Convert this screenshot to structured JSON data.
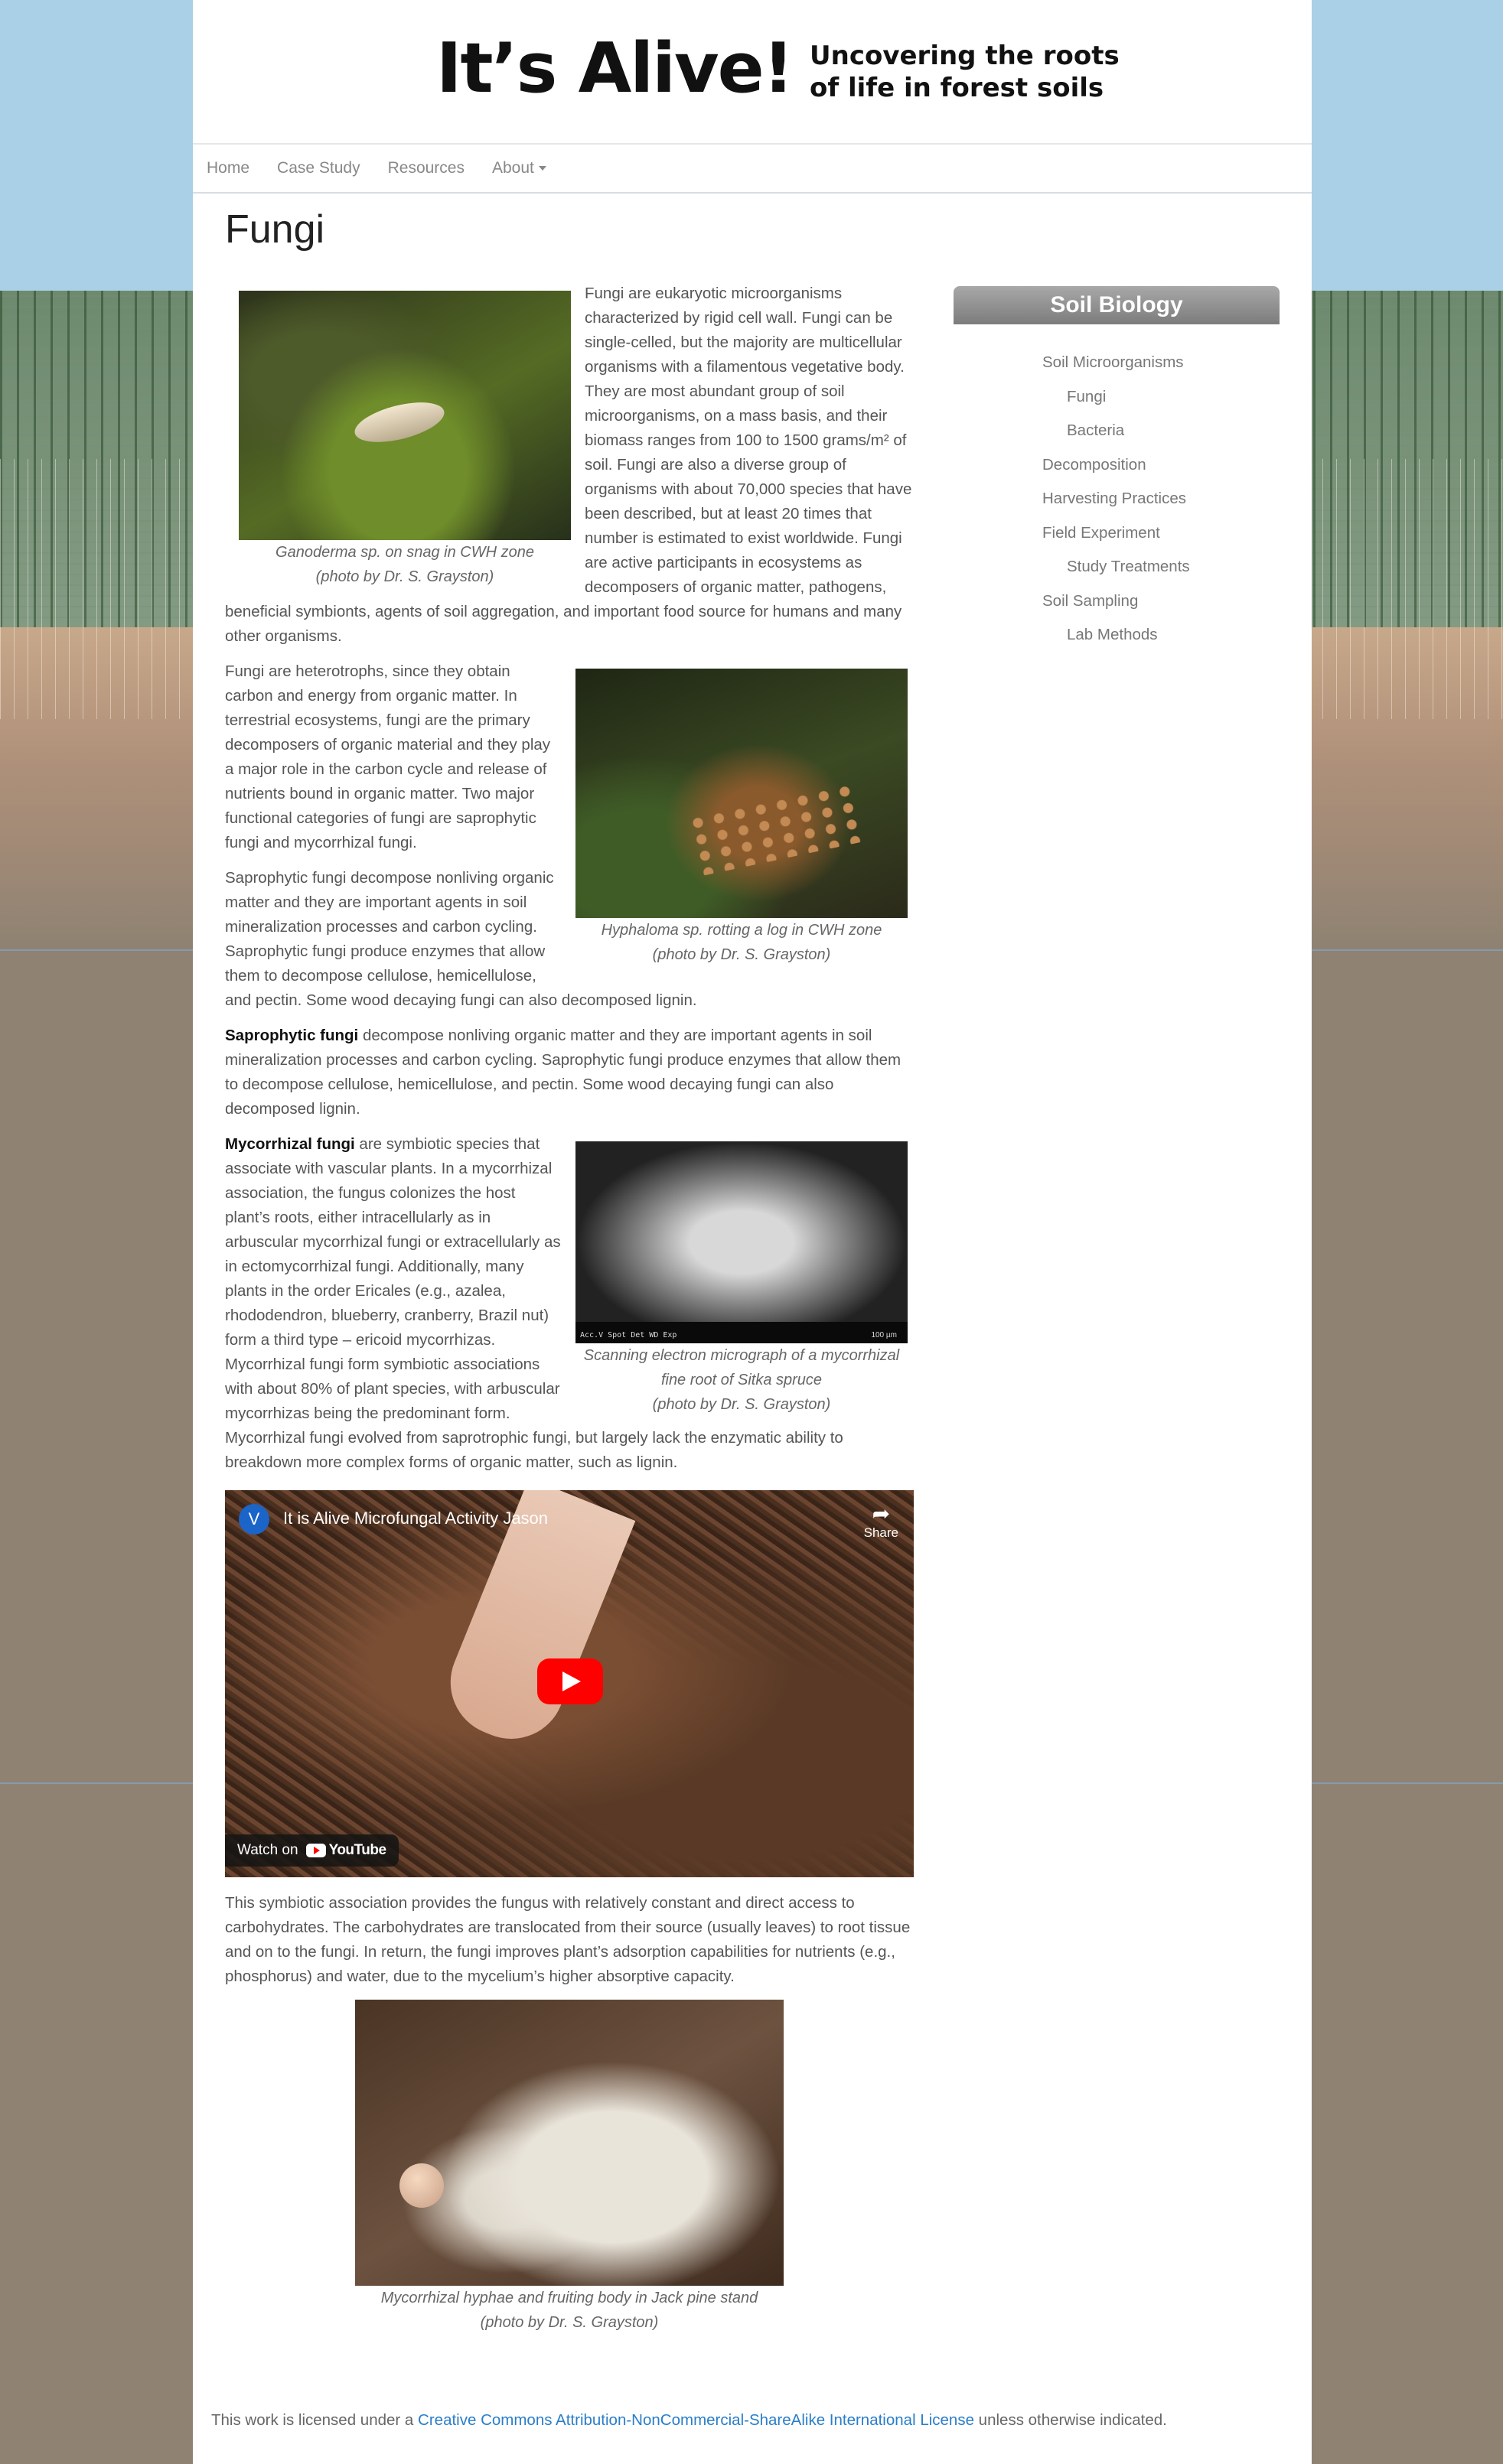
{
  "site": {
    "brand": "It’s Alive!",
    "tagline_line1": "Uncovering the roots",
    "tagline_line2": "of life in forest soils"
  },
  "nav": {
    "home": "Home",
    "case_study": "Case Study",
    "resources": "Resources",
    "about": "About"
  },
  "page": {
    "title": "Fungi"
  },
  "content": {
    "intro": "Fungi are eukaryotic microorganisms characterized by rigid cell wall. Fungi can be single-celled, but the majority are multicellular organisms with a filamentous vegetative body. They are most abundant group of soil microorganisms, on a mass basis, and their biomass ranges from 100 to 1500 grams/m² of soil.  Fungi are also a diverse group of organisms with about 70,000 species that have been described, but at least 20 times that number is estimated to exist worldwide. Fungi are active participants in ecosystems as decomposers of organic matter, pathogens, beneficial symbionts, agents of soil aggregation, and important food source for humans and many other organisms.",
    "fig1_caption_line1": "Ganoderma sp. on snag in CWH zone",
    "fig1_caption_line2": "(photo by Dr. S. Grayston)",
    "heterotrophs": "Fungi are heterotrophs, since they obtain carbon and energy from organic matter. In terrestrial ecosystems, fungi are the primary decomposers of organic material and they play a major role in the carbon cycle and release of nutrients bound in organic matter. Two major functional categories of fungi are saprophytic fungi and mycorrhizal fungi.",
    "fig2_caption_line1": "Hyphaloma sp. rotting a log in CWH zone",
    "fig2_caption_line2": "(photo by Dr. S. Grayston)",
    "sapro_plain": "Saprophytic fungi decompose nonliving organic matter and they are important agents in soil mineralization processes and carbon cycling. Saprophytic fungi produce enzymes that allow them to decompose cellulose, hemicellulose, and pectin. Some wood decaying fungi can also decomposed lignin.",
    "sapro_bold_label": "Saprophytic fungi",
    "sapro_bold_rest": " decompose nonliving organic matter and they are important agents in soil mineralization processes and carbon cycling. Saprophytic fungi produce enzymes that allow them to decompose cellulose, hemicellulose, and pectin. Some wood decaying fungi can also decomposed lignin.",
    "myco_label": "Mycorrhizal fungi",
    "myco_rest": " are symbiotic species that associate with vascular plants. In a mycorrhizal association, the fungus colonizes the host plant’s roots, either intracellularly as in arbuscular mycorrhizal fungi or extracellularly as in ectomycorrhizal fungi. Additionally, many plants in the order Ericales (e.g., azalea, rhododendron, blueberry, cranberry, Brazil nut) form a third type – ericoid mycorrhizas. Mycorrhizal fungi form symbiotic associations with about 80% of plant species, with arbuscular mycorrhizas being the predominant form. Mycorrhizal fungi evolved from saprotrophic fungi, but largely lack the enzymatic ability to breakdown more complex forms of organic matter, such as lignin.",
    "fig3_caption_line1": "Scanning electron micrograph of a mycorrhizal",
    "fig3_caption_line2": "fine root of Sitka spruce",
    "fig3_caption_line3": "(photo by Dr. S. Grayston)",
    "fig3_sem_text": "Acc.V  Spot Det  WD  Exp",
    "fig3_scale_text": "100 µm",
    "symbiosis": "This symbiotic association provides the fungus with relatively constant and direct access to carbohydrates. The carbohydrates are translocated from their source (usually leaves) to root tissue and on to the fungi. In return, the fungi improves plant’s adsorption capabilities for nutrients (e.g., phosphorus) and water, due to the mycelium’s higher absorptive capacity.",
    "fig4_caption_line1": "Mycorrhizal hyphae and fruiting body in Jack pine stand",
    "fig4_caption_line2": "(photo by Dr. S. Grayston)"
  },
  "video": {
    "avatar_letter": "V",
    "title": "It is Alive Microfungal Activity Jason",
    "share": "Share",
    "watch_on": "Watch on",
    "youtube": "YouTube"
  },
  "sidebar": {
    "heading": "Soil Biology",
    "items": [
      {
        "label": "Soil Microorganisms",
        "sub": false
      },
      {
        "label": "Fungi",
        "sub": true
      },
      {
        "label": "Bacteria",
        "sub": true
      },
      {
        "label": "Decomposition",
        "sub": false
      },
      {
        "label": "Harvesting Practices",
        "sub": false
      },
      {
        "label": "Field Experiment",
        "sub": false
      },
      {
        "label": "Study Treatments",
        "sub": true
      },
      {
        "label": "Soil Sampling",
        "sub": false
      },
      {
        "label": "Lab Methods",
        "sub": true
      }
    ]
  },
  "footer": {
    "prefix": "This work is licensed under a ",
    "link": "Creative Commons Attribution-NonCommercial-ShareAlike International License",
    "suffix": " unless otherwise indicated."
  }
}
